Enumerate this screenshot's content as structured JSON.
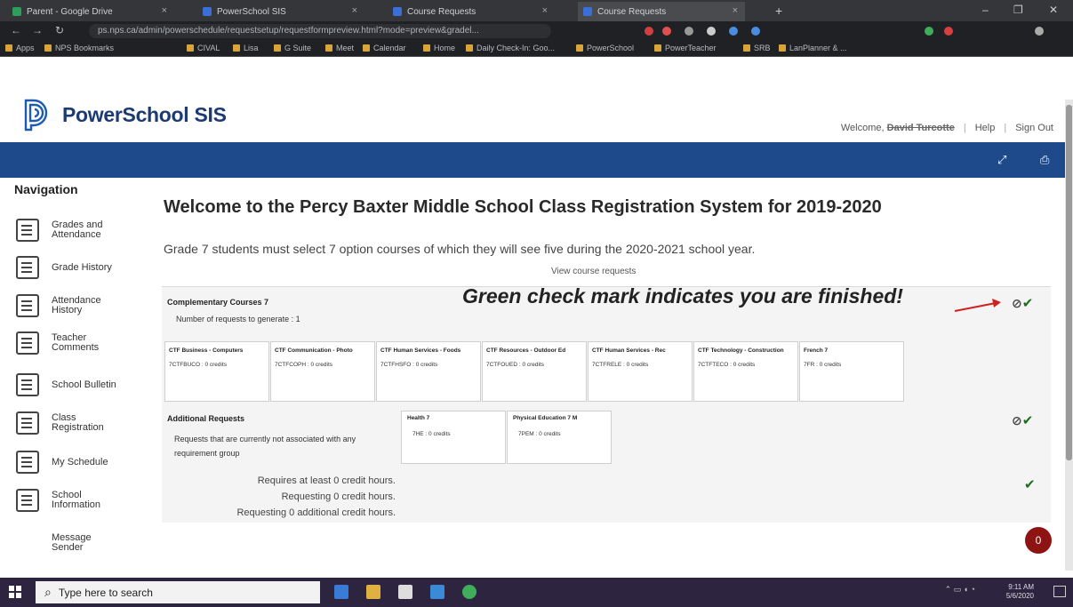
{
  "browser": {
    "tabs": [
      {
        "title": "Parent - Google Drive",
        "icon": "drive"
      },
      {
        "title": "PowerSchool SIS",
        "icon": "ps"
      },
      {
        "title": "Course Requests",
        "icon": "ps"
      },
      {
        "title": "Course Requests",
        "icon": "ps"
      }
    ],
    "url": "ps.nps.ca/admin/powerschedule/requestsetup/requestformpreview.html?mode=preview&gradel...",
    "bookmarks": [
      "Apps",
      "NPS Bookmarks",
      "CIVAL",
      "Lisa",
      "G Suite",
      "Meet",
      "Calendar",
      "Home",
      "Daily Check-In: Goo...",
      "PowerSchool",
      "PowerTeacher",
      "SRB",
      "LanPlanner & ..."
    ]
  },
  "header": {
    "logo_text": "PowerSchool SIS",
    "welcome": "Welcome,",
    "user": "David Turcotte",
    "help": "Help",
    "sign_out": "Sign Out"
  },
  "nav": {
    "title": "Navigation",
    "items": [
      {
        "label": "Grades and\nAttendance",
        "icon": "grades-icon"
      },
      {
        "label": "Grade History",
        "icon": "grade-history-icon"
      },
      {
        "label": "Attendance\nHistory",
        "icon": "attendance-history-icon"
      },
      {
        "label": "Teacher\nComments",
        "icon": "comments-icon"
      },
      {
        "label": "School Bulletin",
        "icon": "bulletin-icon"
      },
      {
        "label": "Class\nRegistration",
        "icon": "registration-icon"
      },
      {
        "label": "My Schedule",
        "icon": "schedule-icon"
      },
      {
        "label": "School\nInformation",
        "icon": "school-info-icon"
      },
      {
        "label": "Message\nSender",
        "icon": ""
      }
    ]
  },
  "main": {
    "title": "Welcome to the Percy Baxter Middle School Class Registration System for 2019-2020",
    "intro": "Grade 7 students must select 7 option courses of which they will see five during the 2020-2021 school year.",
    "view_link": "View course requests",
    "annotation": "Green check mark indicates you are finished!",
    "complementary": {
      "title": "Complementary Courses 7",
      "subtitle": "Number of requests to generate : 1",
      "courses": [
        {
          "name": "CTF Business - Computers",
          "code": "7CTFBUCO : 0 credits"
        },
        {
          "name": "CTF Communication - Photo",
          "code": "7CTFCOPH : 0 credits"
        },
        {
          "name": "CTF Human Services - Foods",
          "code": "7CTFHSFO : 0 credits"
        },
        {
          "name": "CTF Resources - Outdoor Ed",
          "code": "7CTFOUED : 0 credits"
        },
        {
          "name": "CTF Human Services - Rec",
          "code": "7CTFRELE : 0 credits"
        },
        {
          "name": "CTF Technology - Construction",
          "code": "7CTFTECO : 0 credits"
        },
        {
          "name": "French 7",
          "code": "7FR : 0 credits"
        }
      ]
    },
    "additional": {
      "title": "Additional Requests",
      "desc": "Requests that are currently not associated with any requirement group",
      "courses": [
        {
          "name": "Health 7",
          "code": "7HE : 0 credits"
        },
        {
          "name": "Physical Education 7 M",
          "code": "7PEM : 0 credits"
        }
      ]
    },
    "credits": [
      "Requires at least 0 credit hours.",
      "Requesting 0 credit hours.",
      "Requesting 0 additional credit hours."
    ],
    "notification_count": "0"
  },
  "taskbar": {
    "search_placeholder": "Type here to search",
    "time": "9:11 AM",
    "date": "5/6/2020"
  },
  "colors": {
    "brand_blue": "#1e4a8c",
    "check_green": "#1f6d1f",
    "notif_red": "#8e1414"
  }
}
